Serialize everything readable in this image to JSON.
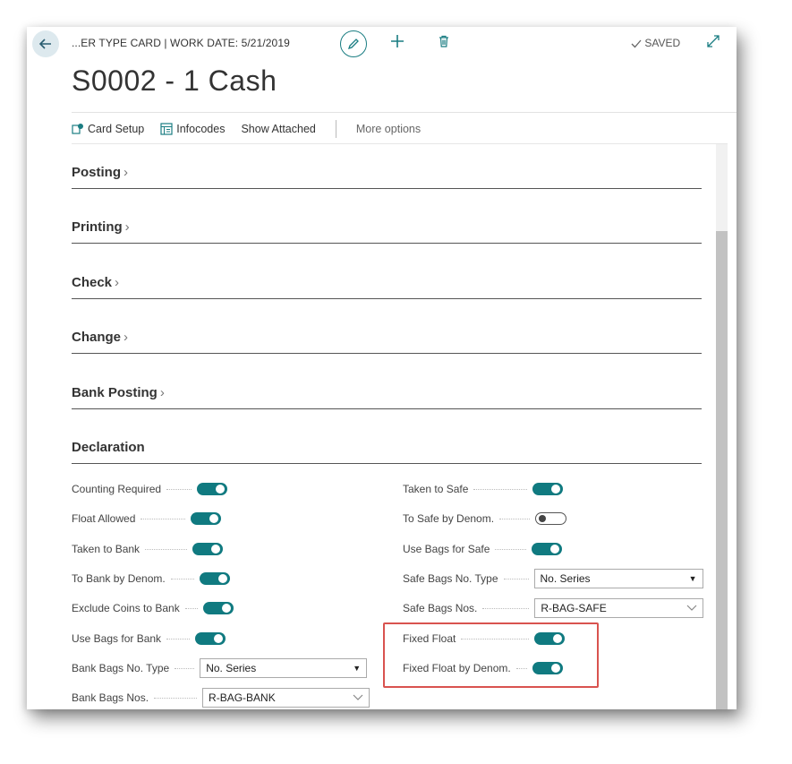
{
  "header": {
    "breadcrumb": "...ER TYPE CARD | WORK DATE: 5/21/2019",
    "title": "S0002 - 1 Cash",
    "saved_label": "SAVED"
  },
  "actions": {
    "card_setup": "Card Setup",
    "infocodes": "Infocodes",
    "show_attached": "Show Attached",
    "more_options": "More options"
  },
  "sections": {
    "posting": "Posting",
    "printing": "Printing",
    "check": "Check",
    "change": "Change",
    "bank_posting": "Bank Posting",
    "declaration": "Declaration"
  },
  "declaration": {
    "left": {
      "counting_required": {
        "label": "Counting Required",
        "value": true
      },
      "float_allowed": {
        "label": "Float Allowed",
        "value": true
      },
      "taken_to_bank": {
        "label": "Taken to Bank",
        "value": true
      },
      "to_bank_by_denom": {
        "label": "To Bank by Denom.",
        "value": true
      },
      "exclude_coins_to_bank": {
        "label": "Exclude Coins to Bank",
        "value": true
      },
      "use_bags_for_bank": {
        "label": "Use Bags for Bank",
        "value": true
      },
      "bank_bags_no_type": {
        "label": "Bank Bags No. Type",
        "value": "No. Series"
      },
      "bank_bags_nos": {
        "label": "Bank Bags Nos.",
        "value": "R-BAG-BANK"
      }
    },
    "right": {
      "taken_to_safe": {
        "label": "Taken to Safe",
        "value": true
      },
      "to_safe_by_denom": {
        "label": "To Safe by Denom.",
        "value": false
      },
      "use_bags_for_safe": {
        "label": "Use Bags for Safe",
        "value": true
      },
      "safe_bags_no_type": {
        "label": "Safe Bags No. Type",
        "value": "No. Series"
      },
      "safe_bags_nos": {
        "label": "Safe Bags Nos.",
        "value": "R-BAG-SAFE"
      },
      "fixed_float": {
        "label": "Fixed Float",
        "value": true
      },
      "fixed_float_by_denom": {
        "label": "Fixed Float by Denom.",
        "value": true
      }
    }
  },
  "colors": {
    "accent": "#107a80",
    "highlight_border": "#d9534f"
  },
  "icons": [
    "back-arrow-icon",
    "pencil-icon",
    "plus-icon",
    "trash-icon",
    "checkmark-icon",
    "expand-icon",
    "card-setup-icon",
    "infocodes-icon",
    "chevron-right-icon",
    "dropdown-caret-icon",
    "chevron-down-icon"
  ]
}
